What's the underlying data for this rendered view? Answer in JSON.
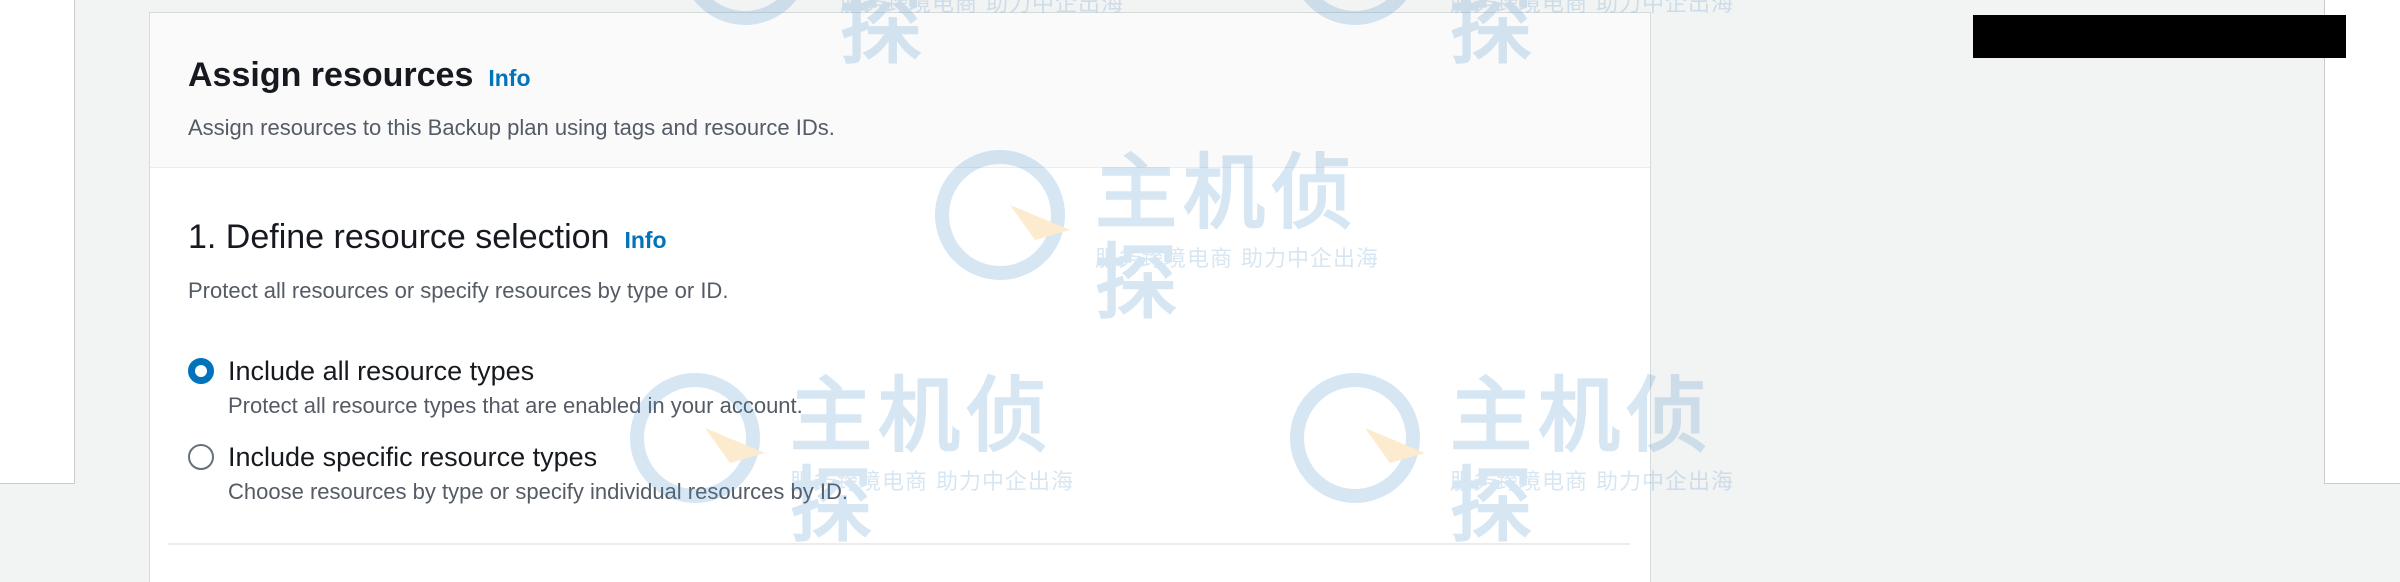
{
  "assign_resources": {
    "title": "Assign resources",
    "info_link": "Info",
    "description": "Assign resources to this Backup plan using tags and resource IDs."
  },
  "resource_selection": {
    "title": "1. Define resource selection",
    "info_link": "Info",
    "description": "Protect all resources or specify resources by type or ID.",
    "options": [
      {
        "label": "Include all resource types",
        "description": "Protect all resource types that are enabled in your account.",
        "selected": true
      },
      {
        "label": "Include specific resource types",
        "description": "Choose resources by type or specify individual resources by ID.",
        "selected": false
      }
    ]
  },
  "watermark": {
    "main": "主机侦探",
    "sub": "服务跨境电商 助力中企出海"
  },
  "colors": {
    "accent": "#0073bb",
    "heading": "#16191f",
    "secondary_text": "#545b64",
    "watermark": "#4a8fc9"
  }
}
